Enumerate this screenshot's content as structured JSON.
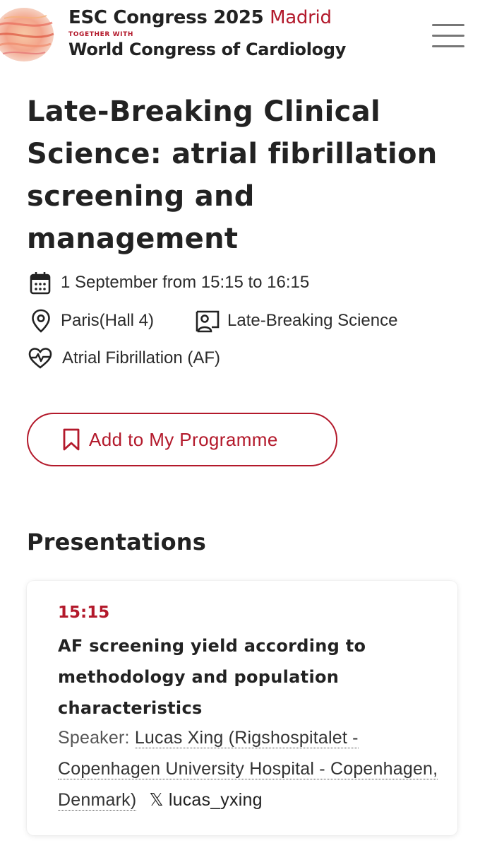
{
  "header": {
    "congress": "ESC Congress 2025",
    "city": "Madrid",
    "tagline": "TOGETHER WITH",
    "partner": "World Congress of Cardiology",
    "menu_icon": "hamburger-menu-icon"
  },
  "session": {
    "title": "Late-Breaking Clinical Science: atrial fibrillation screening and management",
    "date_time": "1 September from 15:15 to 16:15",
    "location": "Paris(Hall 4)",
    "session_type": "Late-Breaking Science",
    "topic": "Atrial Fibrillation (AF)",
    "add_button_label": "Add to My Programme"
  },
  "presentations": {
    "heading": "Presentations",
    "items": [
      {
        "time": "15:15",
        "title": "AF screening yield according to methodology and population characteristics",
        "speaker_label": "Speaker:",
        "speaker": "Lucas Xing (Rigshospitalet - Copenhagen University Hospital - Copenhagen, Denmark)",
        "x_handle": "lucas_yxing"
      }
    ]
  },
  "colors": {
    "accent": "#b3192b",
    "text": "#222222",
    "background": "#ffffff"
  }
}
